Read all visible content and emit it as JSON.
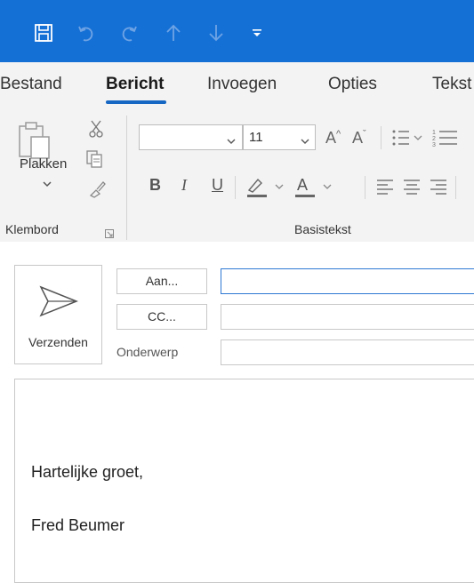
{
  "quick_access": {
    "icons": [
      "save-icon",
      "undo-icon",
      "redo-icon",
      "up-arrow-icon",
      "down-arrow-icon",
      "customize-icon"
    ],
    "titlebar_color": "#1570d6"
  },
  "tabs": [
    {
      "label": "Bestand"
    },
    {
      "label": "Bericht",
      "active": true
    },
    {
      "label": "Invoegen"
    },
    {
      "label": "Opties"
    },
    {
      "label": "Tekst"
    }
  ],
  "ribbon": {
    "clipboard": {
      "paste_label": "Plakken",
      "group_label": "Klembord"
    },
    "basic_text": {
      "font_name": "",
      "font_size": "11",
      "bold": "B",
      "italic": "I",
      "underline": "U",
      "group_label": "Basistekst"
    }
  },
  "compose": {
    "send_label": "Verzenden",
    "to_label": "Aan...",
    "cc_label": "CC...",
    "subject_label": "Onderwerp",
    "to_value": "",
    "cc_value": "",
    "subject_value": "",
    "body_lines": [
      "Hartelijke groet,",
      "Fred Beumer"
    ]
  },
  "colors": {
    "accent": "#1567c3",
    "ribbon_bg": "#f3f3f3"
  }
}
